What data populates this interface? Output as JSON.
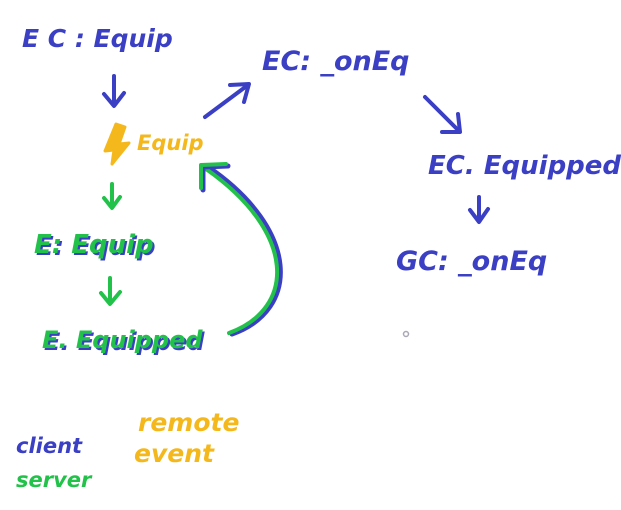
{
  "colors": {
    "client": "#3a3fc4",
    "server": "#22c24a",
    "remote": "#f5b81c",
    "background": "#ffffff",
    "dot": "#a9a9b5"
  },
  "nodes": {
    "client_equip": "E C : Equip",
    "client_on_equip": "EC: _onEq",
    "client_equipped": "EC. Equipped",
    "gc_on_equip": "GC: _onEq",
    "remote_equip": "Equip",
    "server_equip": "E: Equip",
    "server_equipped": "E. Equipped"
  },
  "icons": {
    "remote_event": "lightning-bolt-icon"
  },
  "legend": {
    "client": "client",
    "server": "server",
    "remote_line1": "remote",
    "remote_line2": "event"
  }
}
